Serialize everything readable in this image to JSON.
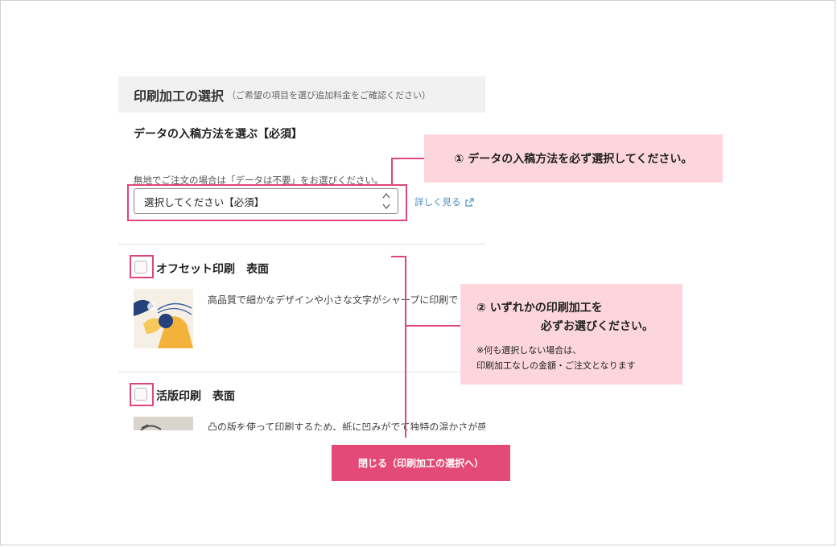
{
  "panel": {
    "title": "印刷加工の選択",
    "subtitle": "（ご希望の項目を選び追加料金をご確認ください）"
  },
  "data_method": {
    "heading": "データの入稿方法を選ぶ【必須】",
    "note": "無地でご注文の場合は「データは不要」をお選びください。",
    "select_value": "選択してください【必須】",
    "details_link": "詳しく見る"
  },
  "items": [
    {
      "title": "オフセット印刷　表面",
      "description": "高品質で細かなデザインや小さな文字がシャープに印刷で",
      "checked": false
    },
    {
      "title": "活版印刷　表面",
      "description": "凸の版を使って印刷するため、紙に凹みがでて独特の温かさが感",
      "checked": false
    }
  ],
  "callouts": {
    "first": "① データの入稿方法を必ず選択してください。",
    "second_line1": "② いずれかの印刷加工を",
    "second_line2": "必ずお選びください。",
    "second_note1": "※何も選択しない場合は、",
    "second_note2": "印刷加工なしの金額・ご注文となります"
  },
  "close_button": "閉じる（印刷加工の選択へ）",
  "colors": {
    "accent": "#e0457b",
    "button": "#e44a77",
    "callout_bg": "#fcd6dc",
    "link": "#4a90c2",
    "header_bg": "#f1f1f1"
  }
}
